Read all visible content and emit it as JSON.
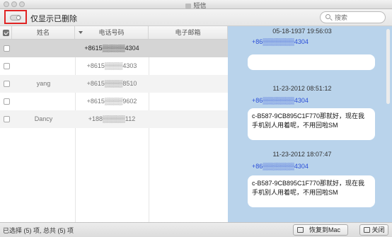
{
  "window": {
    "title": "短信"
  },
  "toolbar": {
    "toggle_label": "仅显示已删除",
    "toggle_on": false
  },
  "search": {
    "placeholder": "搜索",
    "value": ""
  },
  "table": {
    "headers": {
      "name": "姓名",
      "phone": "电话号码",
      "email": "电子邮箱"
    },
    "header_checked": true,
    "rows": [
      {
        "name": "",
        "phone": "+8615▒▒▒▒▒4304",
        "email": "",
        "selected": true,
        "checked": false
      },
      {
        "name": "",
        "phone": "+8615▒▒▒▒4303",
        "email": "",
        "selected": false,
        "checked": false
      },
      {
        "name": "yang",
        "phone": "+8615▒▒▒▒8510",
        "email": "",
        "selected": false,
        "checked": false
      },
      {
        "name": "",
        "phone": "+8615▒▒▒▒9602",
        "email": "",
        "selected": false,
        "checked": false
      },
      {
        "name": "Dancy",
        "phone": "+188▒▒▒▒▒112",
        "email": "",
        "selected": false,
        "checked": false
      }
    ]
  },
  "conversation": {
    "messages": [
      {
        "timestamp": "05-18-1937 19:56:03",
        "sender": "+86▒▒▒▒▒▒▒4304",
        "text": ""
      },
      {
        "timestamp": "11-23-2012 08:51:12",
        "sender": "+86▒▒▒▒▒▒▒4304",
        "text": "c-B587-9CB895C1F770那就好，现在我手机别人用着呢，不用回啦SM"
      },
      {
        "timestamp": "11-23-2012 18:07:47",
        "sender": "+86▒▒▒▒▒▒▒4304",
        "text": "c-B587-9CB895C1F770那就好，现在我手机别人用着呢，不用回啦SM"
      }
    ]
  },
  "status": {
    "summary": "已选择 (5) 项, 总共 (5) 项",
    "restore_label": "恢复到Mac",
    "close_label": "关闭"
  },
  "colors": {
    "highlight": "#e02424",
    "sender": "#2a4ed8",
    "conversation_bg": "#b9d3eb"
  },
  "icons": [
    "window-icon",
    "search-icon",
    "restore-icon",
    "close-icon"
  ]
}
